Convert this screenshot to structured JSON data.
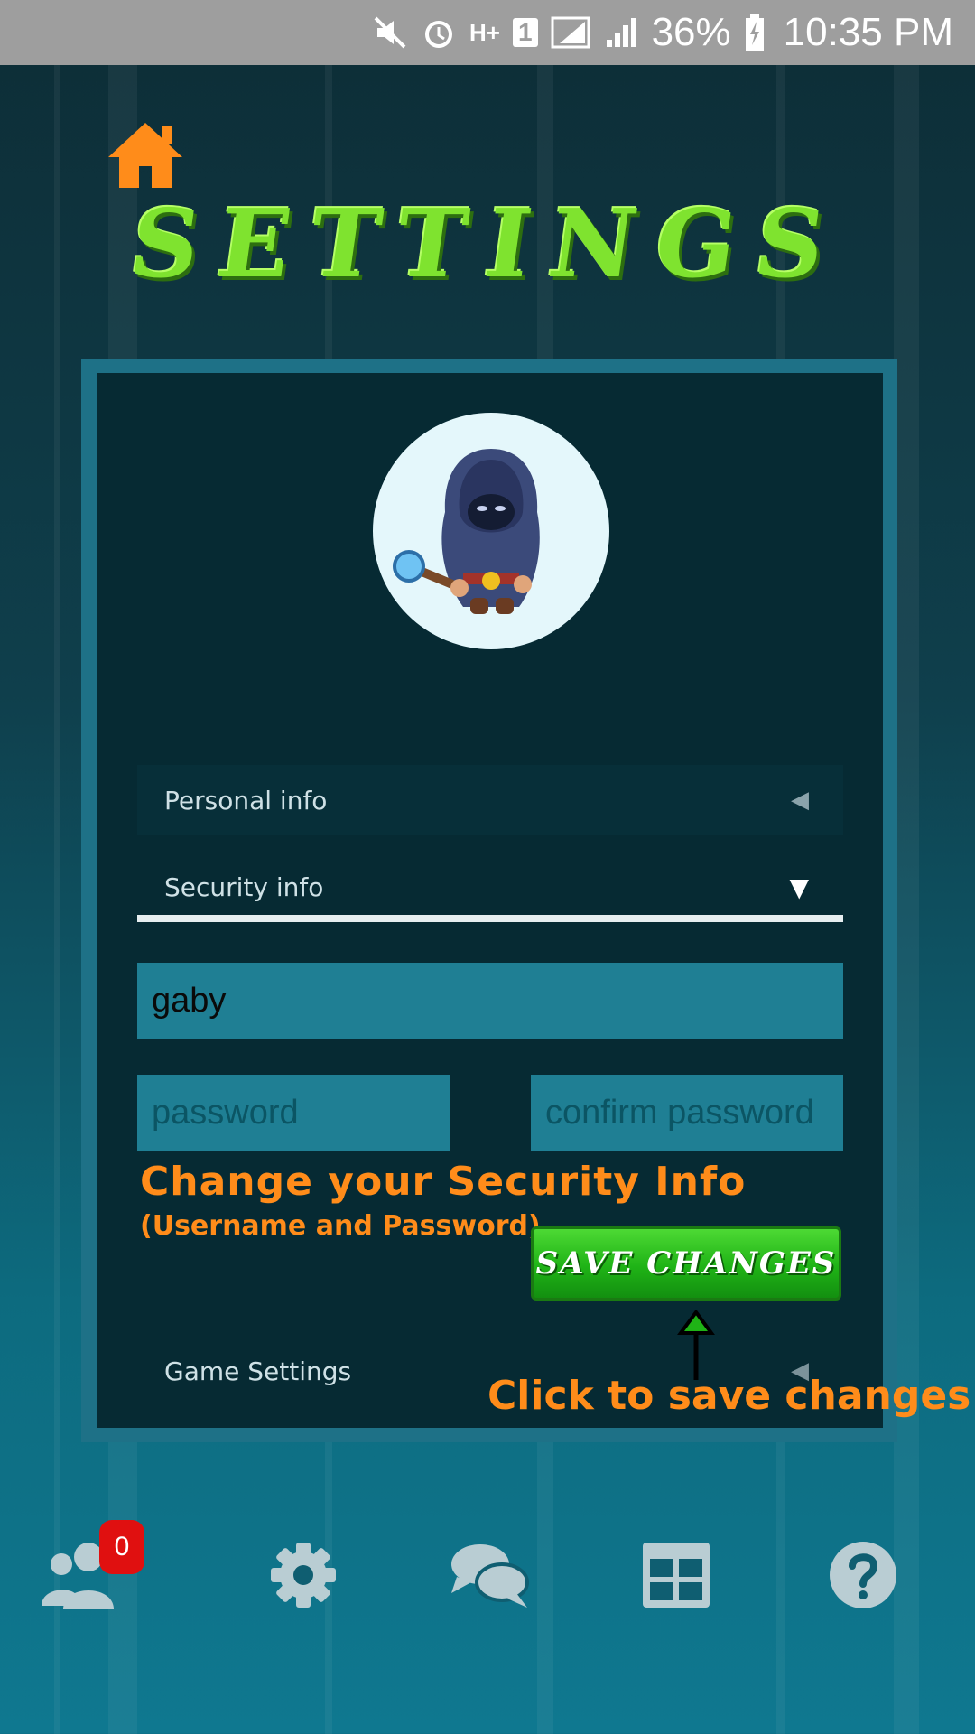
{
  "status_bar": {
    "network": "H+",
    "sim": "1",
    "battery": "36%",
    "time": "10:35 PM"
  },
  "title": "SETTINGS",
  "panel": {
    "personal_info_label": "Personal info",
    "security_info_label": "Security info",
    "username_value": "gaby",
    "password_placeholder": "password",
    "confirm_password_placeholder": "confirm password",
    "game_settings_label": "Game Settings",
    "save_button_label": "SAVE CHANGES"
  },
  "annotations": {
    "security_title": "Change your Security Info",
    "security_sub": "(Username and Password)",
    "save_hint": "Click to save changes"
  },
  "bottom_nav": {
    "friends_badge": "0",
    "items": [
      "friends-icon",
      "gear-icon",
      "chat-icon",
      "table-icon",
      "help-icon"
    ]
  },
  "colors": {
    "accent_orange": "#ff8c1a",
    "title_green": "#7fe32f",
    "save_green": "#1fb316",
    "badge_red": "#e01010"
  }
}
